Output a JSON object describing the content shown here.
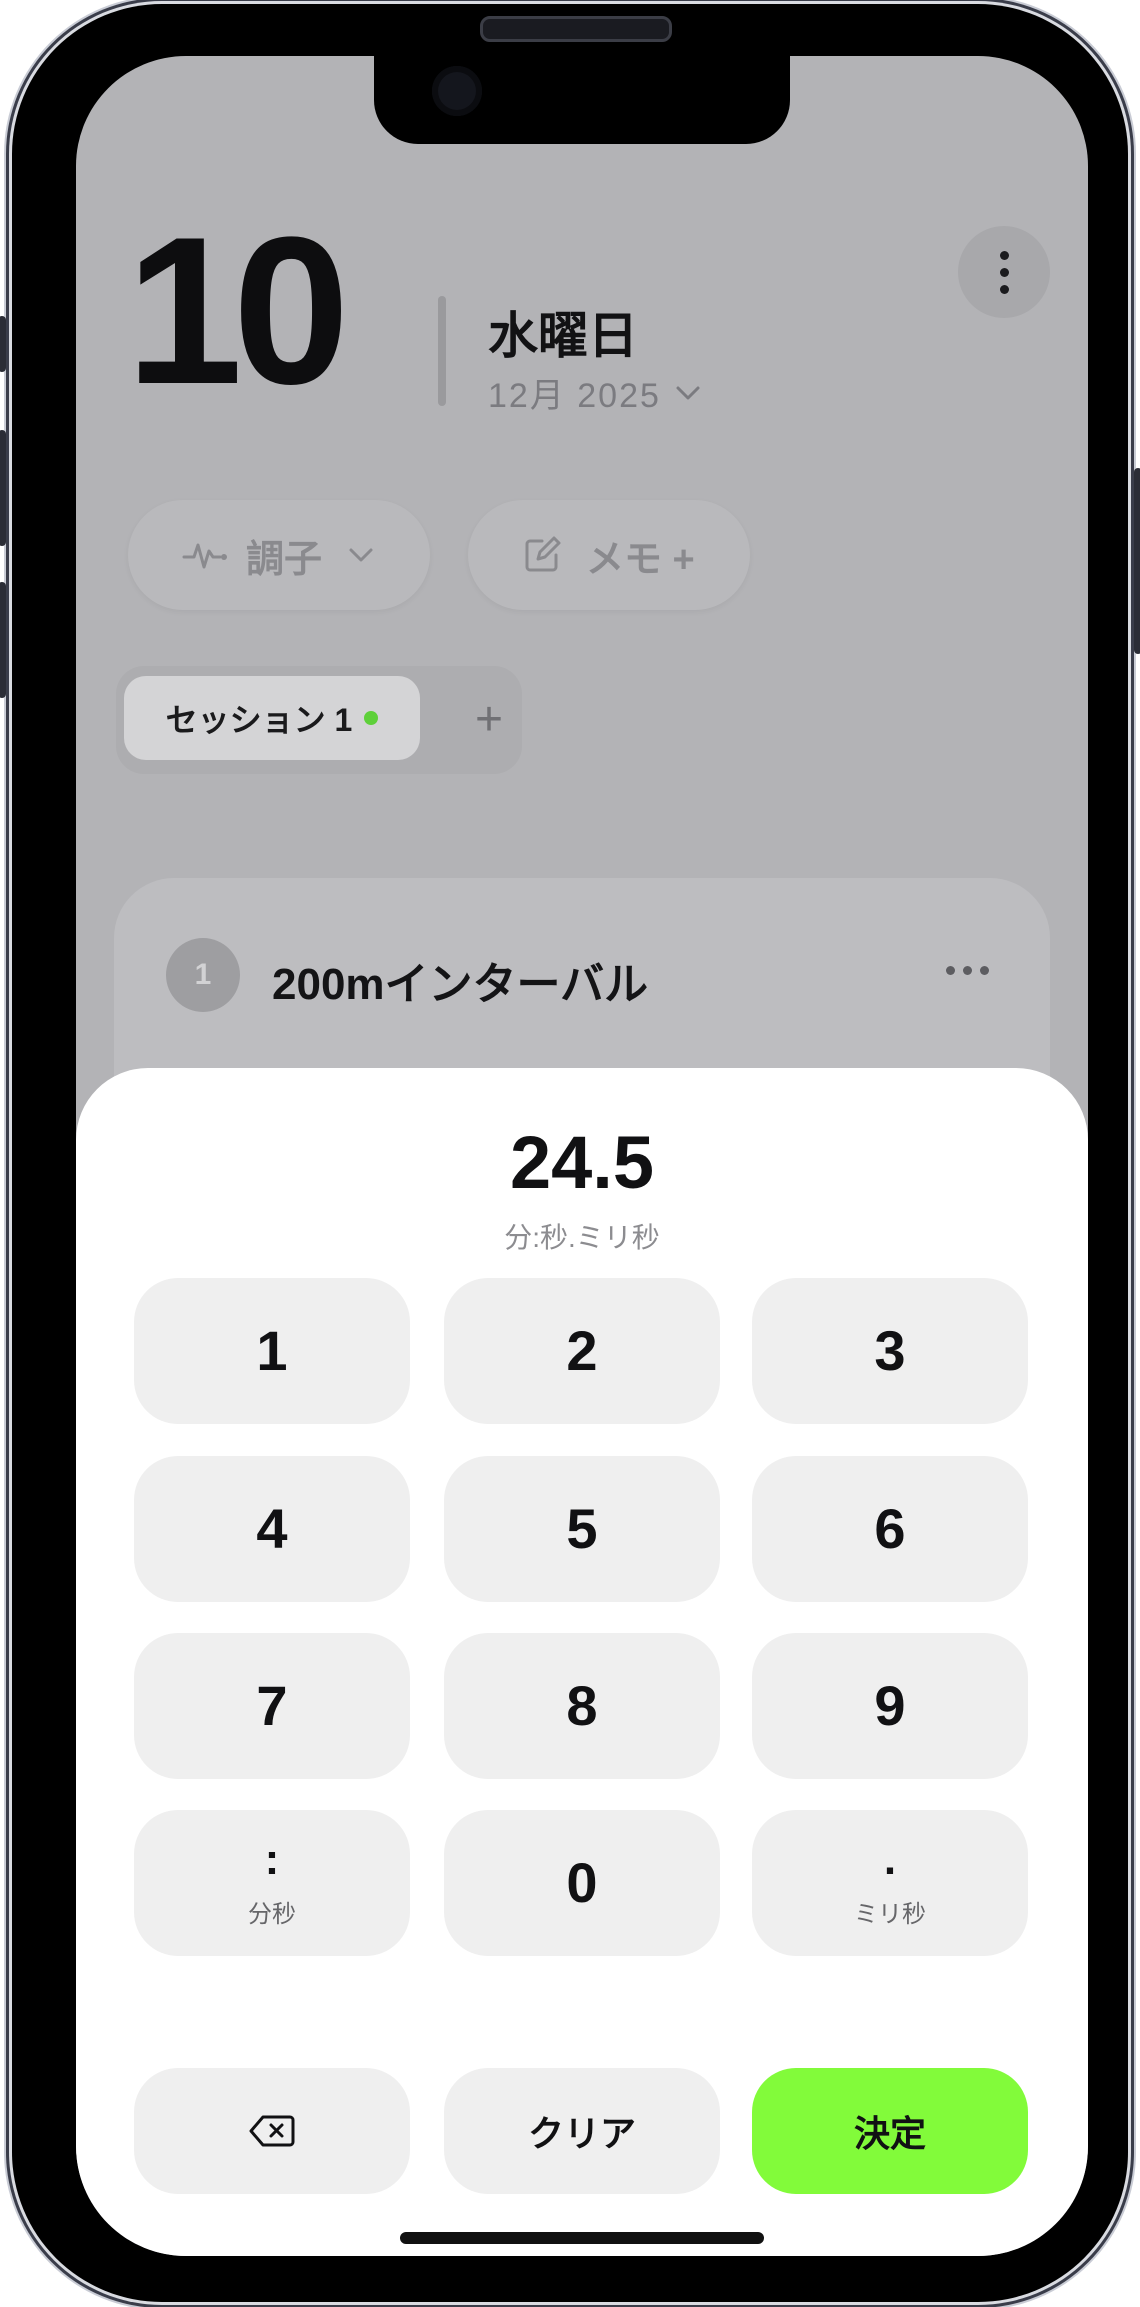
{
  "header": {
    "day": "10",
    "weekday": "水曜日",
    "month_year": "12月 2025"
  },
  "chips": {
    "condition_label": "調子",
    "memo_label": "メモ +"
  },
  "sessions": {
    "tabs": [
      {
        "label": "セッション 1",
        "active": true
      }
    ],
    "add_label": "+"
  },
  "card": {
    "step": "1",
    "title": "200mインターバル"
  },
  "keypad": {
    "value": "24.5",
    "format_hint": "分:秒.ミリ秒",
    "keys": [
      {
        "label": "1"
      },
      {
        "label": "2"
      },
      {
        "label": "3"
      },
      {
        "label": "4"
      },
      {
        "label": "5"
      },
      {
        "label": "6"
      },
      {
        "label": "7"
      },
      {
        "label": "8"
      },
      {
        "label": "9"
      },
      {
        "label": ":",
        "sub": "分秒"
      },
      {
        "label": "0"
      },
      {
        "label": ".",
        "sub": "ミリ秒"
      }
    ],
    "clear_label": "クリア",
    "confirm_label": "決定"
  },
  "colors": {
    "confirm": "#82fb3a",
    "session_dot": "#5ed03a"
  },
  "icons": [
    "pulse-icon",
    "chevron-down-icon",
    "edit-note-icon",
    "plus-icon",
    "more-vertical-icon",
    "more-horizontal-icon",
    "backspace-icon"
  ]
}
